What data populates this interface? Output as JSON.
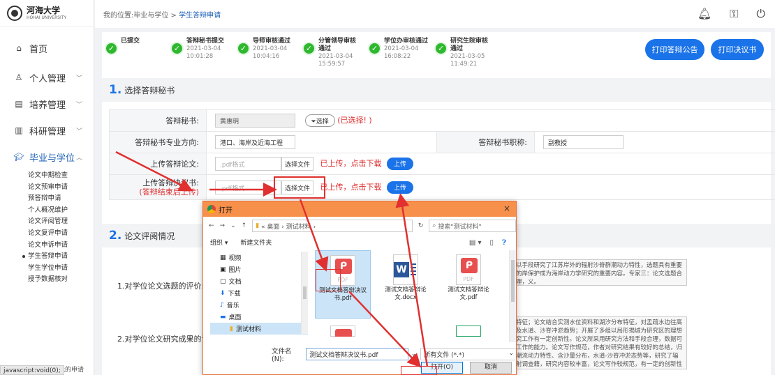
{
  "sidebar": {
    "logo_cn": "河海大学",
    "logo_en": "HOHAI UNIVERSITY",
    "menu": [
      {
        "label": "首页",
        "icon": "home-icon"
      },
      {
        "label": "个人管理",
        "icon": "user-icon"
      },
      {
        "label": "培养管理",
        "icon": "book-icon"
      },
      {
        "label": "科研管理",
        "icon": "chart-icon"
      },
      {
        "label": "毕业与学位",
        "icon": "graduation-icon"
      }
    ],
    "submenu": [
      "论文中期检查",
      "论文预审申请",
      "预答辩申请",
      "个人概况维护",
      "论文评阅管理",
      "论文复评申请",
      "论文申诉申请",
      "学生答辩申请",
      "学生学位申请",
      "授予数据核对"
    ],
    "current_sub": "学生答辩申请",
    "status_text": "javascript:void(0);",
    "bottom_link": "我的申请"
  },
  "topbar": {
    "breadcrumb_prefix": "我的位置:毕业与学位 >",
    "breadcrumb_current": "学生答辩申请"
  },
  "steps": [
    {
      "name": "已提交",
      "date": "",
      "time": ""
    },
    {
      "name": "答辩秘书提交",
      "date": "2021-03-04",
      "time": "10:01:28"
    },
    {
      "name": "导师审核通过",
      "date": "2021-03-04",
      "time": "10:04:16"
    },
    {
      "name": "分管领导审核通过",
      "date": "2021-03-04",
      "time": "15:59:57"
    },
    {
      "name": "学位办审核通过",
      "date": "2021-03-04",
      "time": "16:08:22"
    },
    {
      "name": "研究生院审核通过",
      "date": "2021-03-05",
      "time": "11:49:21"
    }
  ],
  "buttons": {
    "print_notice": "打印答辩公告",
    "print_decision": "打印决议书"
  },
  "section1": {
    "num": "1.",
    "title": "选择答辩秘书",
    "secretary_label": "答辩秘书:",
    "secretary_value": "黄惠明",
    "select_btn": "选择",
    "selected_note": "(已选择! )",
    "major_label": "答辩秘书专业方向:",
    "major_value": "港口、海岸及近海工程",
    "title_label": "答辩秘书职称:",
    "title_value": "副教授",
    "thesis_label": "上传答辩论文:",
    "thesis_placeholder": ".pdf格式",
    "choose_file": "选择文件",
    "uploaded_note": "已上传，点击下载",
    "upload_btn": "上传",
    "decision_label": "上传答辩决议书:",
    "decision_hint": "(答辩结束后上传)",
    "decision_placeholder": ".pdf格式"
  },
  "section2": {
    "num": "2.",
    "title": "论文评阅情况",
    "q1": "1.对学位论文选题的评价:",
    "q1_text": "以手段研究了江苏岸外的辐射沙脊群潮动力特性，选题具有重要的岸保护成为海岸动力学研究的重要内容。专家三：论文选题合理，义。",
    "q2": "2.对学位论文研究成果的评价:",
    "q2_text": "特征；论文结合实测水位资料和湖汐分布特征，对盂疏水边往高及水道、沙脊冲淤趋势；开展了多组以局形揭城为研究区的理想究工作有一定创新性。论文所采用研究方法和手段合理，数据可工作的能力。论文写作规范，作者对研究结果有较好的总结，归潮流动力特性、含沙量分布，水道-沙脊冲淤态势等，研究了辐射调查籍，研究内容较丰富，论文写作较规范，有一定的创新性"
  },
  "dialog": {
    "title": "打开",
    "close": "×",
    "path": "« 桌面 › 测试材料 ›",
    "search_placeholder": "搜索\"测试材料\"",
    "organize": "组织 ▾",
    "new_folder": "新建文件夹",
    "nav": [
      {
        "label": "视频",
        "icon": "video-icon"
      },
      {
        "label": "图片",
        "icon": "picture-icon"
      },
      {
        "label": "文档",
        "icon": "document-icon"
      },
      {
        "label": "下载",
        "icon": "download-icon"
      },
      {
        "label": "音乐",
        "icon": "music-icon"
      },
      {
        "label": "桌面",
        "icon": "desktop-icon"
      },
      {
        "label": "测试材料",
        "icon": "folder-icon"
      }
    ],
    "files": [
      {
        "name": "测试文档答辩决议书.pdf",
        "type": "pdf"
      },
      {
        "name": "测试文档答辩论文.docx",
        "type": "word"
      },
      {
        "name": "测试文档答辩论文.pdf",
        "type": "pdf"
      }
    ],
    "filename_label": "文件名(N):",
    "filename_value": "测试文档答辩决议书.pdf",
    "filetype_value": "所有文件 (*.*)",
    "open_btn": "打开(O)",
    "cancel_btn": "取消"
  },
  "colors": {
    "accent": "#1a73e8",
    "success": "#2eb82e",
    "annotation": "#e03030",
    "dialog_title": "#f7904b"
  }
}
